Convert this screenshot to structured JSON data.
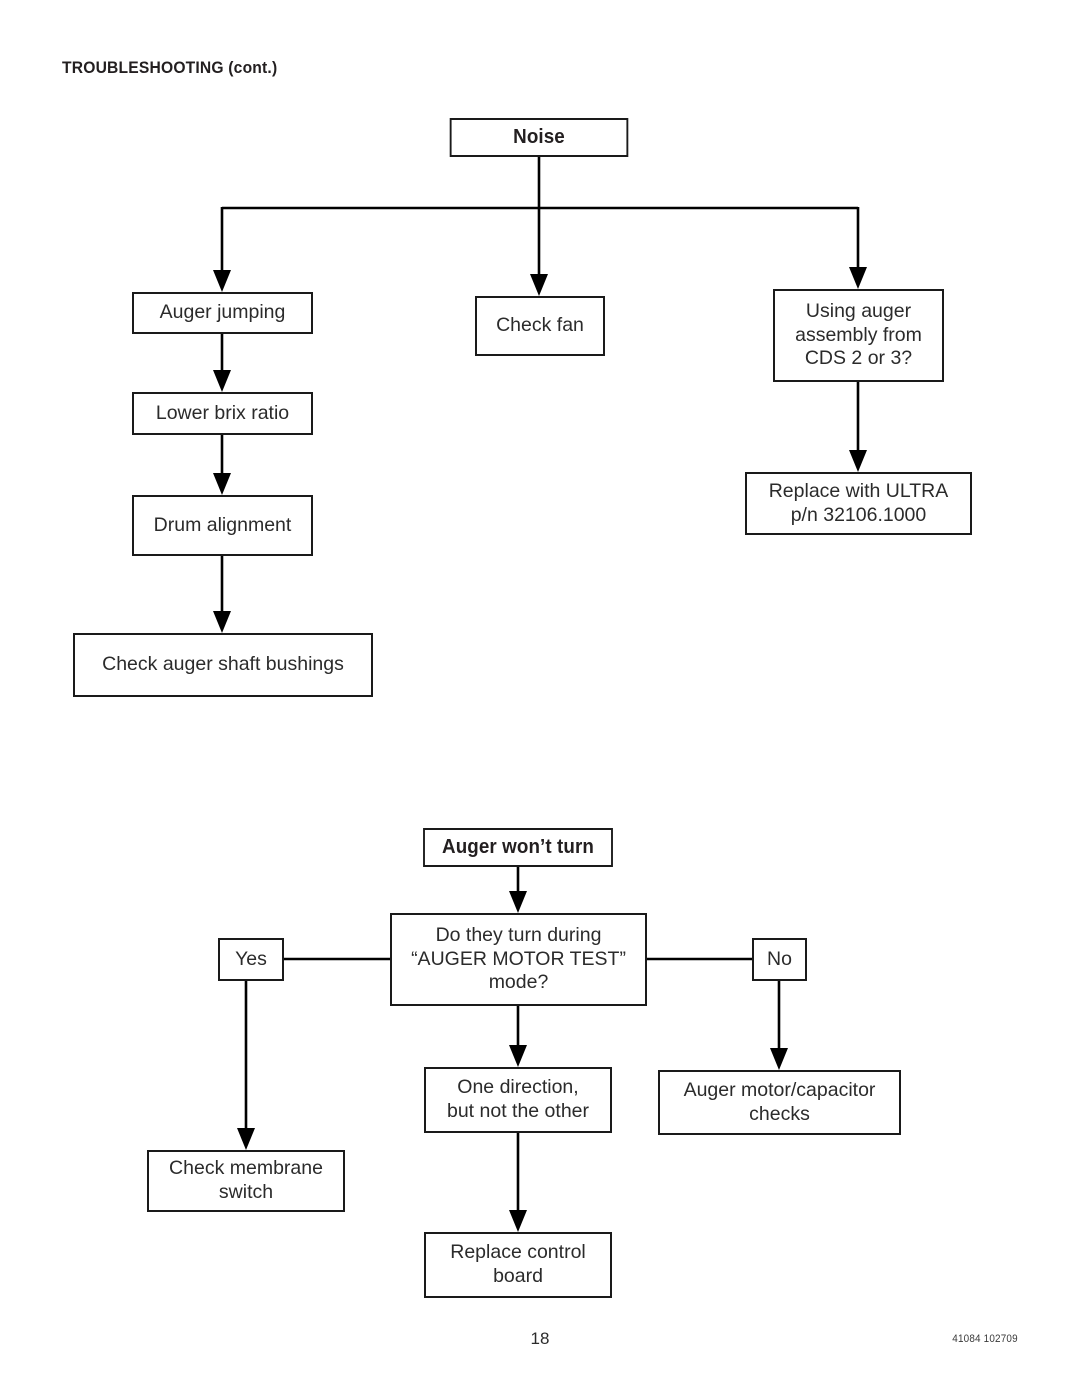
{
  "document": {
    "header": "TROUBLESHOOTING (cont.)",
    "page_number": "18",
    "doc_code": "41084 102709"
  },
  "flowchart_noise": {
    "title": "Noise",
    "root": {
      "label": "Noise"
    },
    "branch_left": [
      {
        "label": "Auger jumping"
      },
      {
        "label": "Lower brix ratio"
      },
      {
        "label": "Drum alignment"
      },
      {
        "label": "Check auger shaft bushings"
      }
    ],
    "branch_middle": [
      {
        "label": "Check fan"
      }
    ],
    "branch_right": [
      {
        "label": "Using auger\nassembly from\nCDS 2 or 3?"
      },
      {
        "label": "Replace with ULTRA\np/n 32106.1000"
      }
    ]
  },
  "flowchart_auger": {
    "title": "Auger won’t turn",
    "root": {
      "label": "Auger won’t turn"
    },
    "decision": {
      "label": "Do they turn during\n“AUGER MOTOR TEST”\nmode?"
    },
    "answer_yes": {
      "label": "Yes"
    },
    "answer_no": {
      "label": "No"
    },
    "yes_path": [
      {
        "label": "Check membrane\nswitch"
      }
    ],
    "down_path": [
      {
        "label": "One direction,\nbut not the other"
      },
      {
        "label": "Replace control\nboard"
      }
    ],
    "no_path": [
      {
        "label": "Auger motor/capacitor\nchecks"
      }
    ]
  }
}
